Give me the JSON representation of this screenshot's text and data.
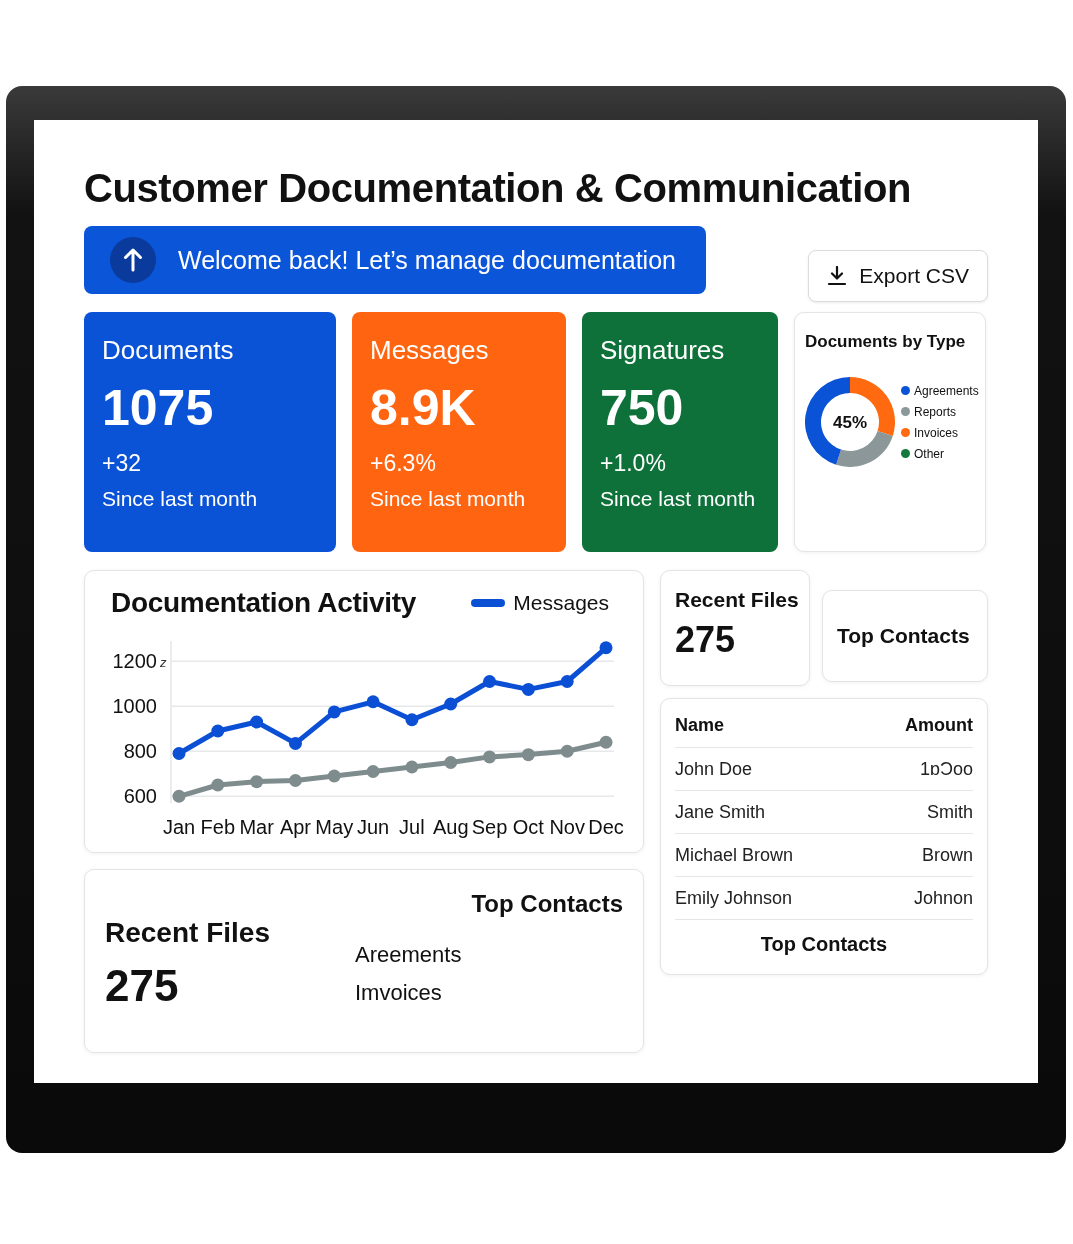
{
  "title": "Customer Documentation & Communication",
  "banner": {
    "text": "Welcome back! Let’s manage documentation"
  },
  "export_button": {
    "label": "Export CSV"
  },
  "stats": [
    {
      "label": "Documents",
      "value": "1075",
      "change": "+32",
      "period": "Since last month",
      "color": "#0a52d6"
    },
    {
      "label": "Messages",
      "value": "8.9K",
      "change": "+6.3%",
      "period": "Since last month",
      "color": "#ff6510"
    },
    {
      "label": "Signatures",
      "value": "750",
      "change": "+1.0%",
      "period": "Since last month",
      "color": "#0e7139"
    }
  ],
  "documents_by_type": {
    "title": "Documents by Type",
    "center_label": "45%",
    "legend": [
      {
        "label": "Agreements",
        "color": "#0a52d6"
      },
      {
        "label": "Reports",
        "color": "#8c979a"
      },
      {
        "label": "Invoices",
        "color": "#ff6a10"
      },
      {
        "label": "Other",
        "color": "#137a3c"
      }
    ]
  },
  "activity": {
    "chart_data": {
      "type": "line",
      "title": "Documentation Activity",
      "categories": [
        "Jan",
        "Feb",
        "Mar",
        "Apr",
        "May",
        "Jun",
        "Jul",
        "Aug",
        "Sep",
        "Oct",
        "Nov",
        "Dec"
      ],
      "series": [
        {
          "name": "Messages",
          "color": "#0b4fd4",
          "marker": "circle",
          "values": [
            790,
            890,
            930,
            835,
            975,
            1020,
            940,
            1010,
            1110,
            1075,
            1110,
            1260
          ]
        },
        {
          "color": "#7f8c8d",
          "marker": "circle",
          "values": [
            600,
            650,
            665,
            670,
            690,
            710,
            730,
            750,
            775,
            785,
            800,
            840
          ]
        }
      ],
      "ylim": [
        570,
        1290
      ],
      "yticks": [
        600,
        800,
        1000,
        1200
      ],
      "grid": true,
      "annotations": [
        "z"
      ]
    }
  },
  "recent_files_card": {
    "title": "Recent Files",
    "count": "275"
  },
  "top_contacts_card": {
    "title": "Top Contacts"
  },
  "contacts_table": {
    "columns": [
      "Name",
      "Amount"
    ],
    "rows": [
      [
        "John Doe",
        "1ɒƆoo"
      ],
      [
        "Jane Smith",
        "Smith"
      ],
      [
        "Michael Brown",
        "Brown"
      ],
      [
        "Emily Johnson",
        "Johnon"
      ]
    ],
    "footer": "Top Contacts"
  },
  "bottom_card": {
    "title": "Recent Files",
    "count": "275",
    "items": [
      "Areements",
      "Imvoices"
    ],
    "side_heading": "Top Contacts"
  }
}
